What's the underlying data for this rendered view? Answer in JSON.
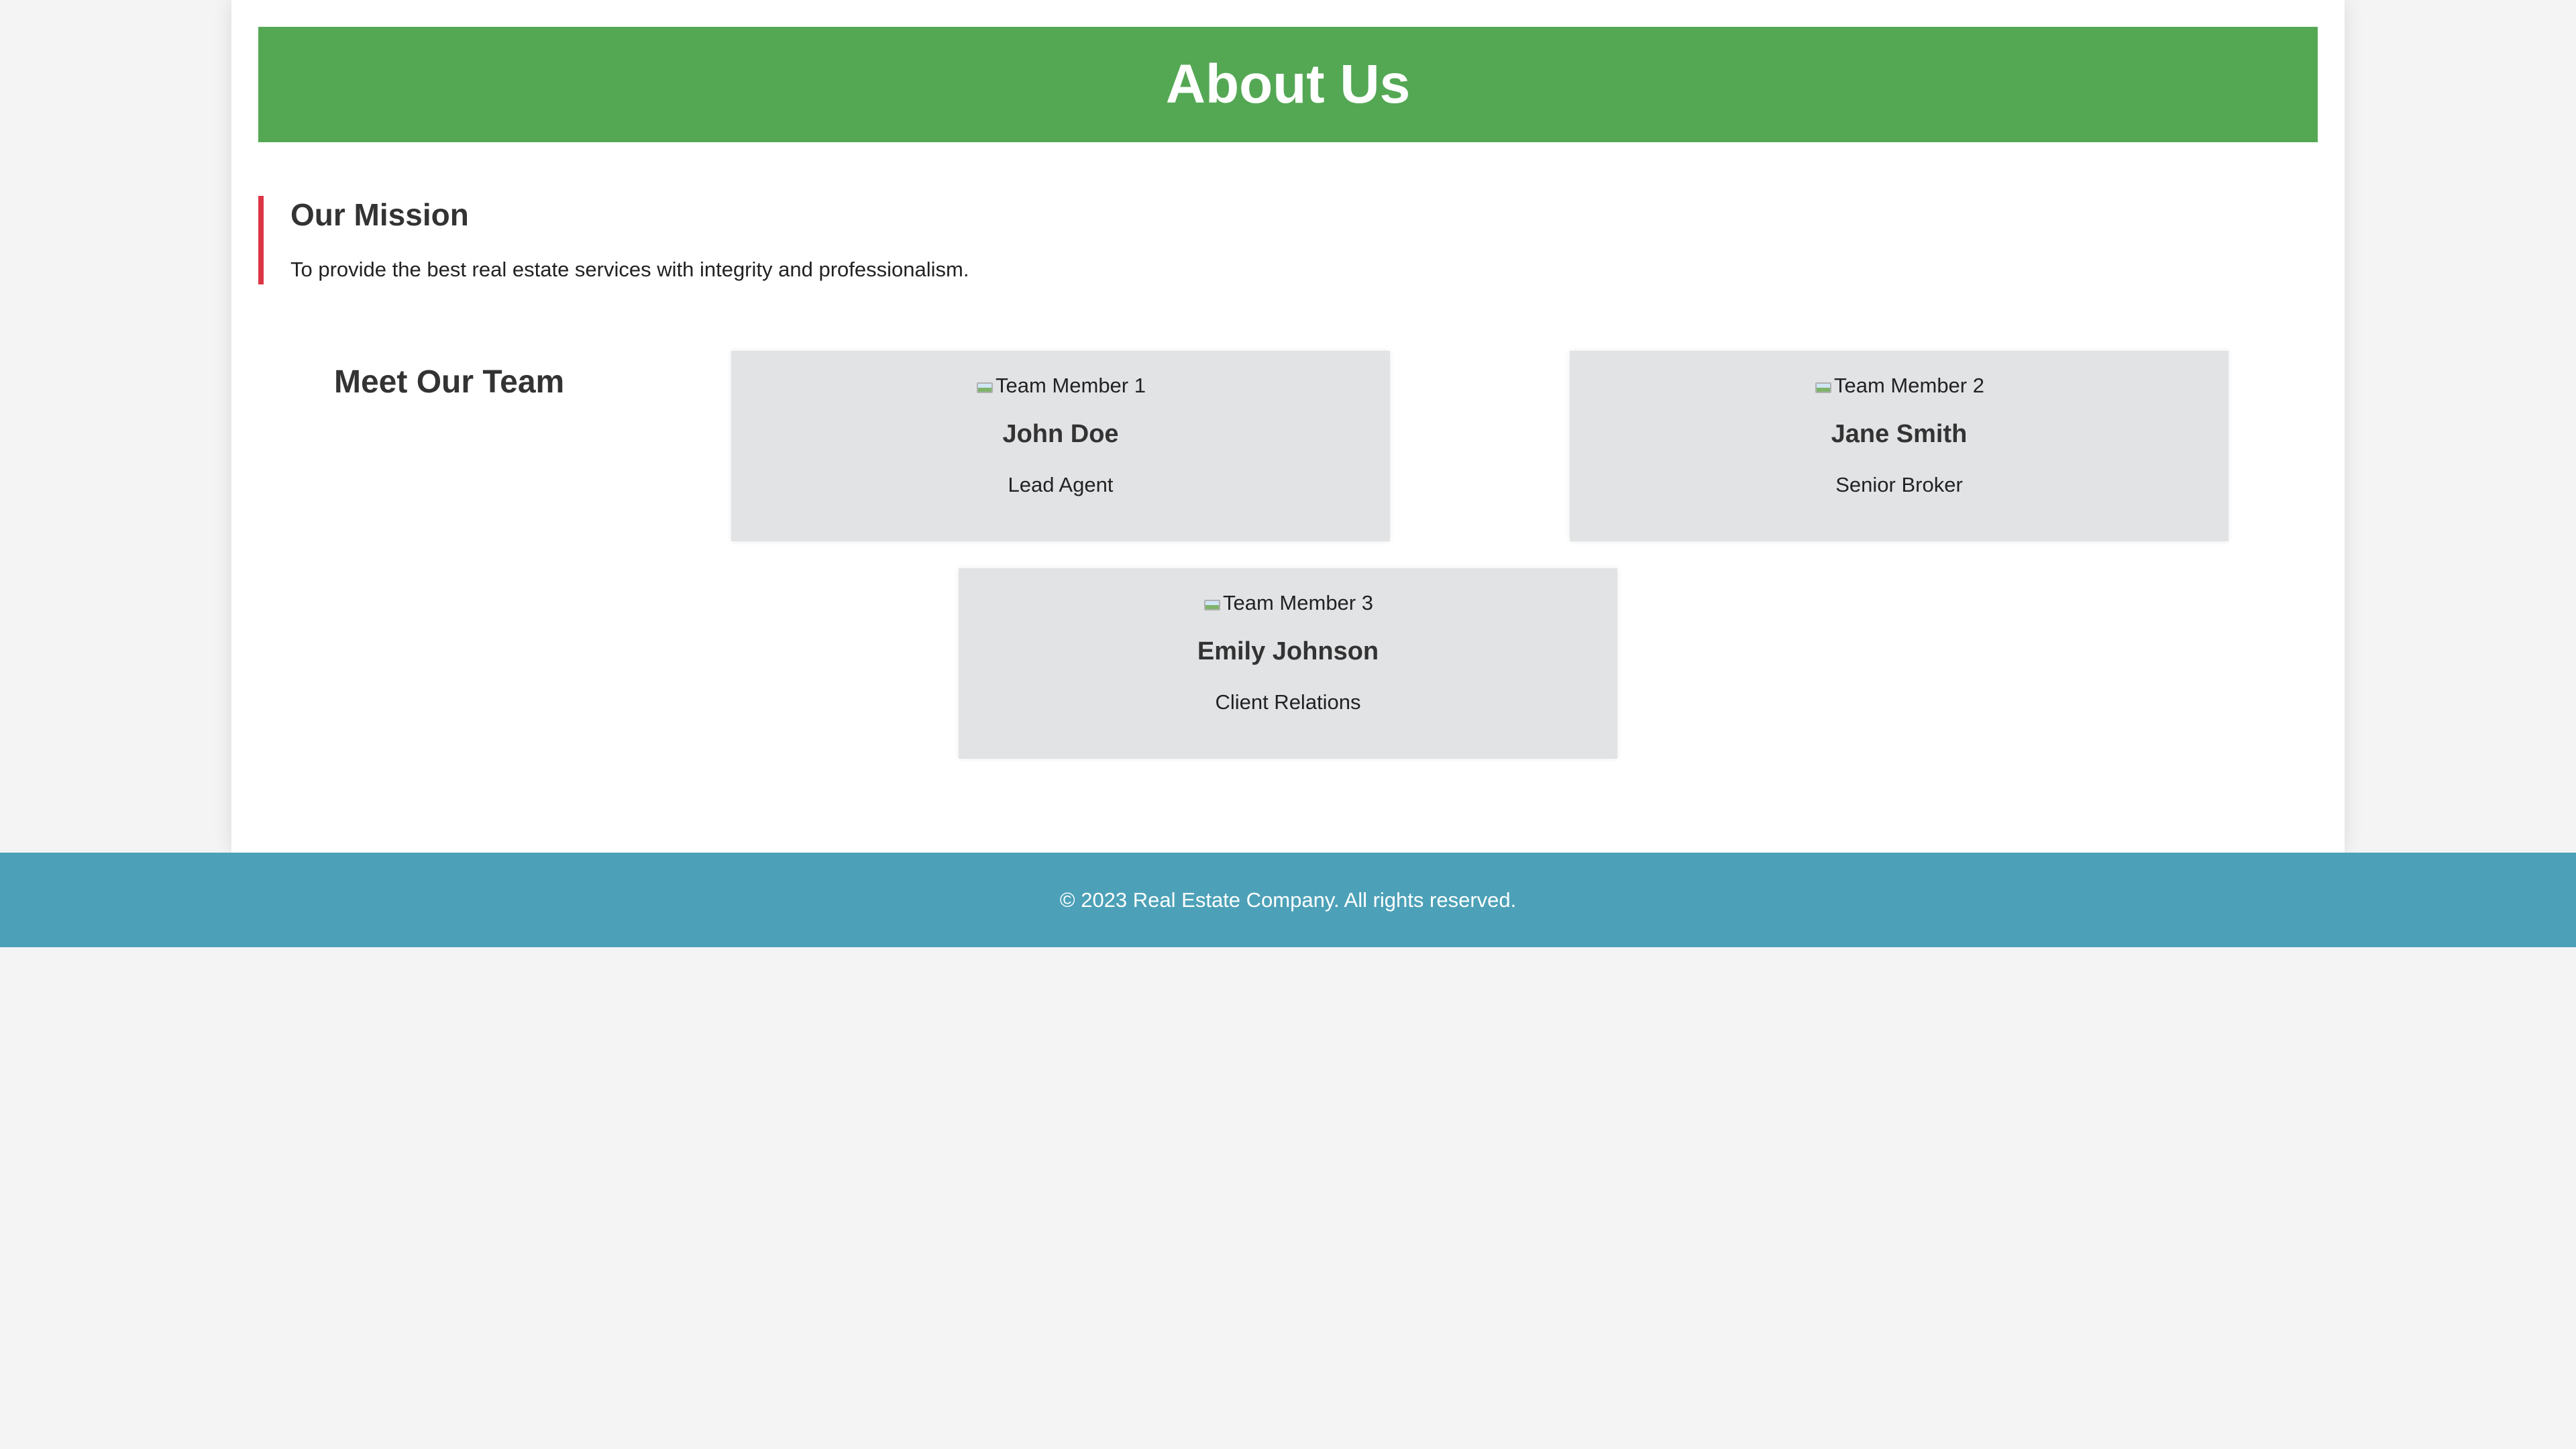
{
  "header": {
    "title": "About Us",
    "background_color": "#54a854"
  },
  "mission": {
    "heading": "Our Mission",
    "text": "To provide the best real estate services with integrity and professionalism.",
    "accent_color": "#dc3545"
  },
  "team": {
    "heading": "Meet Our Team",
    "members": [
      {
        "image_alt": "Team Member 1",
        "name": "John Doe",
        "role": "Lead Agent"
      },
      {
        "image_alt": "Team Member 2",
        "name": "Jane Smith",
        "role": "Senior Broker"
      },
      {
        "image_alt": "Team Member 3",
        "name": "Emily Johnson",
        "role": "Client Relations"
      }
    ]
  },
  "footer": {
    "text": "© 2023 Real Estate Company. All rights reserved.",
    "background_color": "#4ca1b8"
  }
}
